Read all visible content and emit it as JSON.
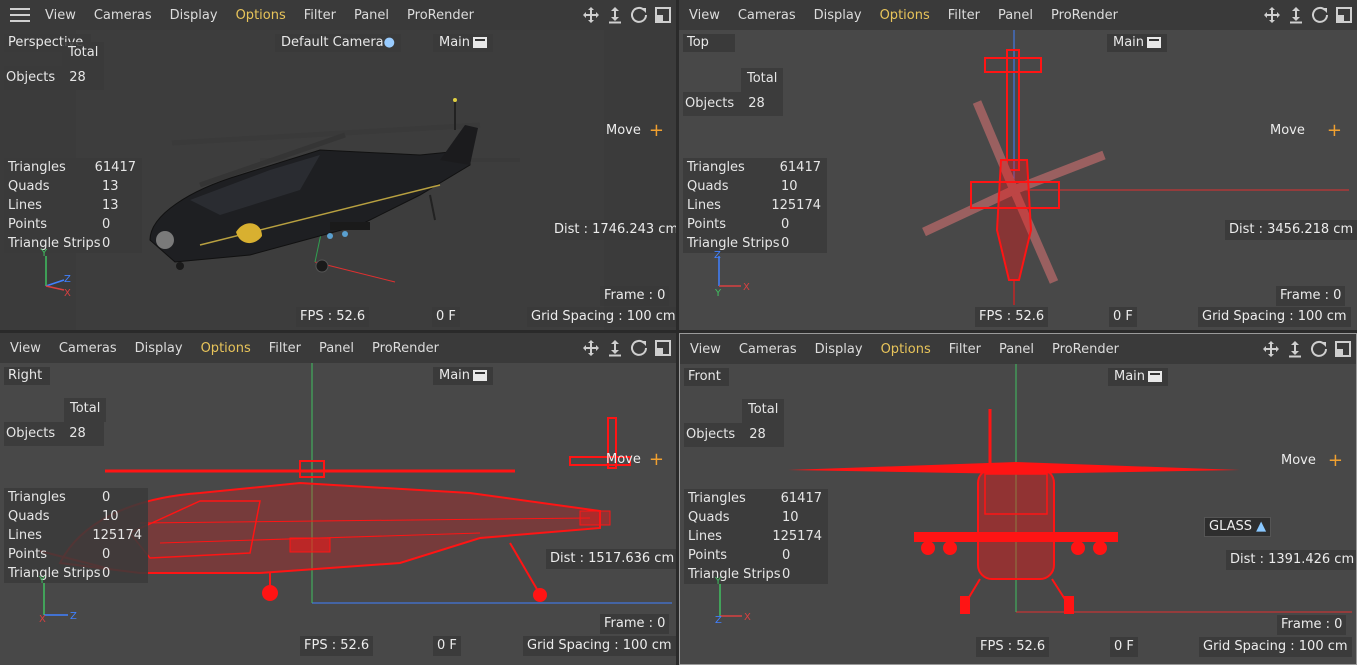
{
  "menu": {
    "items": [
      "View",
      "Cameras",
      "Display",
      "Options",
      "Filter",
      "Panel",
      "ProRender"
    ],
    "active_index": 3
  },
  "stats_labels": {
    "total": "Total",
    "objects": "Objects",
    "triangles": "Triangles",
    "quads": "Quads",
    "lines": "Lines",
    "points": "Points",
    "triangle_strips": "Triangle Strips"
  },
  "common": {
    "move_label": "Move",
    "main_label": "Main",
    "fps_prefix": "FPS : ",
    "frame_prefix": "Frame : ",
    "grid_prefix": "Grid Spacing : ",
    "dist_prefix": "Dist : "
  },
  "viewports": {
    "perspective": {
      "name": "Perspective",
      "camera": "Default Camera",
      "stats": {
        "objects": "28",
        "triangles": "61417",
        "quads": "13",
        "lines": "13",
        "points": "0",
        "triangle_strips": "0"
      },
      "dist": "Dist : 1746.243 cm",
      "frame": "Frame : 0",
      "fps": "FPS : 52.6",
      "frame_marker": "0 F",
      "grid": "Grid Spacing : 100 cm"
    },
    "top": {
      "name": "Top",
      "stats": {
        "objects": "28",
        "triangles": "61417",
        "quads": "10",
        "lines": "125174",
        "points": "0",
        "triangle_strips": "0"
      },
      "dist": "Dist : 3456.218 cm",
      "frame": "Frame : 0",
      "fps": "FPS : 52.6",
      "frame_marker": "0 F",
      "grid": "Grid Spacing : 100 cm"
    },
    "right": {
      "name": "Right",
      "stats": {
        "objects": "28",
        "triangles": "0",
        "quads": "10",
        "lines": "125174",
        "points": "0",
        "triangle_strips": "0"
      },
      "dist": "Dist : 1517.636 cm",
      "frame": "Frame : 0",
      "fps": "FPS : 52.6",
      "frame_marker": "0 F",
      "grid": "Grid Spacing : 100 cm"
    },
    "front": {
      "name": "Front",
      "stats": {
        "objects": "28",
        "triangles": "61417",
        "quads": "10",
        "lines": "125174",
        "points": "0",
        "triangle_strips": "0"
      },
      "dist": "Dist : 1391.426 cm",
      "frame": "Frame : 0",
      "fps": "FPS : 52.6",
      "frame_marker": "0 F",
      "grid": "Grid Spacing : 100 cm",
      "tag": "GLASS"
    }
  },
  "colors": {
    "wire": "#ff1414",
    "active_menu": "#e8c45a",
    "move_plus": "#f0a030",
    "axis_x": "#d84040",
    "axis_y": "#40c060",
    "axis_z": "#4080ff"
  },
  "icons": [
    "move-view-icon",
    "zoom-view-icon",
    "rotate-view-icon",
    "maximize-view-icon",
    "menu-icon",
    "clapboard-icon",
    "glass-material-icon"
  ]
}
